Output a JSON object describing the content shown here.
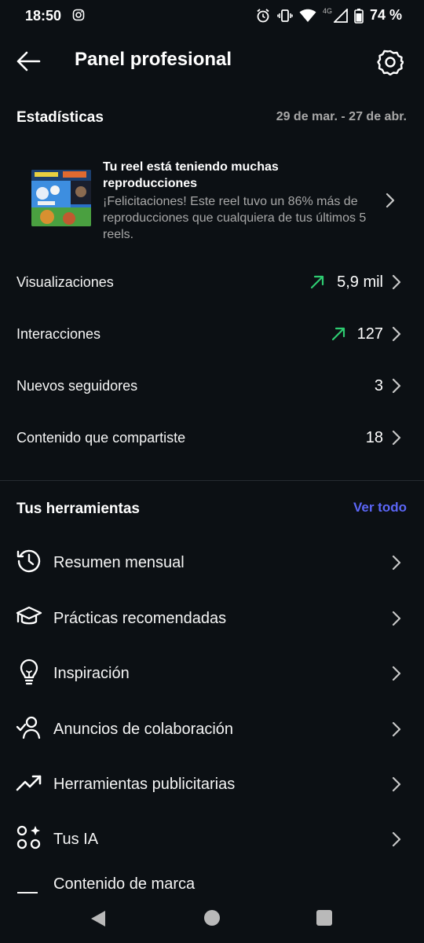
{
  "status_bar": {
    "time": "18:50",
    "network": "4G",
    "battery": "74 %",
    "icons": [
      "instagram-icon",
      "alarm-icon",
      "vibrate-icon",
      "wifi-icon",
      "signal-icon",
      "battery-icon"
    ]
  },
  "header": {
    "title": "Panel profesional",
    "back_icon": "arrow-left-icon",
    "settings_icon": "gear-icon"
  },
  "stats": {
    "title": "Estadísticas",
    "date_range": "29 de mar. - 27 de abr.",
    "banner": {
      "title": "Tu reel está teniendo muchas reproducciones",
      "text": "¡Felicitaciones! Este reel tuvo un 86% más de reproducciones que cualquiera de tus últimos 5 reels."
    },
    "rows": [
      {
        "label": "Visualizaciones",
        "value": "5,9 mil",
        "trend": "up"
      },
      {
        "label": "Interacciones",
        "value": "127",
        "trend": "up"
      },
      {
        "label": "Nuevos seguidores",
        "value": "3"
      },
      {
        "label": "Contenido que compartiste",
        "value": "18"
      }
    ]
  },
  "tools": {
    "title": "Tus herramientas",
    "see_all": "Ver todo",
    "items": [
      {
        "label": "Resumen mensual",
        "icon": "history-icon"
      },
      {
        "label": "Prácticas recomendadas",
        "icon": "graduation-cap-icon"
      },
      {
        "label": "Inspiración",
        "icon": "lightbulb-icon"
      },
      {
        "label": "Anuncios de colaboración",
        "icon": "person-check-icon"
      },
      {
        "label": "Herramientas publicitarias",
        "icon": "trending-up-icon"
      },
      {
        "label": "Tus IA",
        "icon": "ai-sparkle-icon"
      },
      {
        "label": "Contenido de marca",
        "icon": "branded-content-icon"
      }
    ]
  },
  "colors": {
    "background": "#0c1014",
    "accent_link": "#5b66f6",
    "trend_up": "#2ecc71",
    "secondary_text": "#a8a8a8"
  }
}
